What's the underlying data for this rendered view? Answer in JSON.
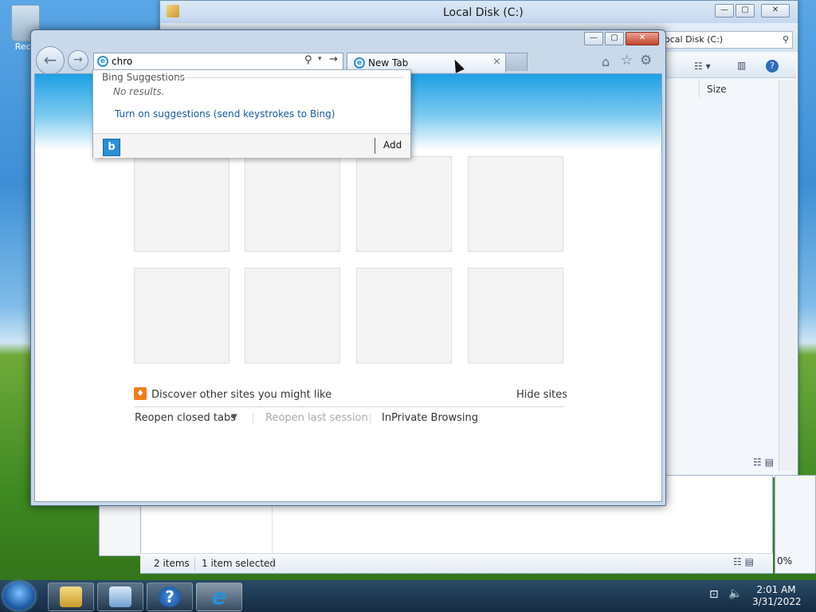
{
  "desktop": {
    "recycle_label": "Recy"
  },
  "explorer_back": {
    "title": "Local Disk (C:)",
    "address_value": "ocal Disk (C:)",
    "column_size": "Size",
    "controls": {
      "min": "—",
      "max": "▢",
      "close": "✕"
    }
  },
  "explorer_front": {
    "status_items": "2 items",
    "status_selected": "1 item selected",
    "zoom_fragment": "0%"
  },
  "ie": {
    "address_value": "chro",
    "tab_label": "New Tab",
    "tab_close": "×",
    "back_glyph": "←",
    "forward_glyph": "→",
    "suggestions": {
      "header": "Bing Suggestions",
      "no_results": "No results.",
      "enable_link": "Turn on suggestions (send keystrokes to Bing)",
      "add_label": "Add",
      "bing_glyph": "b"
    },
    "discover_text": "Discover other sites you might like",
    "hide_sites": "Hide sites",
    "reopen_closed": "Reopen closed tabs",
    "reopen_last": "Reopen last session",
    "inprivate": "InPrivate Browsing"
  },
  "taskbar": {
    "time": "2:01 AM",
    "date": "3/31/2022",
    "help_glyph": "?",
    "ie_glyph": "e"
  },
  "colors": {
    "accent": "#1ea0e4",
    "link": "#1a5aa0",
    "muted": "#aaaaaa"
  }
}
